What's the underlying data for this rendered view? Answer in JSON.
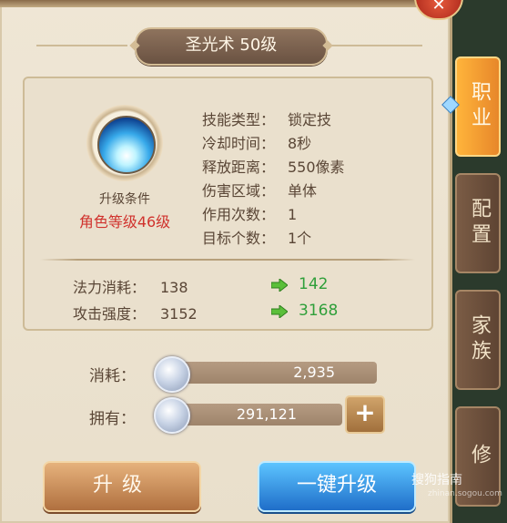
{
  "title": "圣光术 50级",
  "requirement": {
    "title": "升级条件",
    "value": "角色等级46级"
  },
  "stats": [
    {
      "key": "技能类型：",
      "value": "锁定技"
    },
    {
      "key": "冷却时间：",
      "value": "8秒"
    },
    {
      "key": "释放距离：",
      "value": "550像素"
    },
    {
      "key": "伤害区域：",
      "value": "单体"
    },
    {
      "key": "作用次数：",
      "value": "1"
    },
    {
      "key": "目标个数：",
      "value": "1个"
    }
  ],
  "compare": [
    {
      "key": "法力消耗：",
      "current": "138",
      "next": "142"
    },
    {
      "key": "攻击强度：",
      "current": "3152",
      "next": "3168"
    }
  ],
  "resources": {
    "cost_label": "消耗：",
    "cost_value": "2,935",
    "own_label": "拥有：",
    "own_value": "291,121"
  },
  "buttons": {
    "upgrade": "升级",
    "one_click": "一键升级",
    "plus": "+",
    "close": "✕"
  },
  "tabs": [
    {
      "label": "职业",
      "active": true
    },
    {
      "label": "配置",
      "active": false
    },
    {
      "label": "家族",
      "active": false
    },
    {
      "label": "修",
      "active": false
    }
  ],
  "watermark": {
    "text": "搜狗指南",
    "sub": "zhinan.sogou.com"
  },
  "colors": {
    "requirement": "#d0322d",
    "increase": "#2f9f3a",
    "active_tab": "#ffb43b"
  }
}
